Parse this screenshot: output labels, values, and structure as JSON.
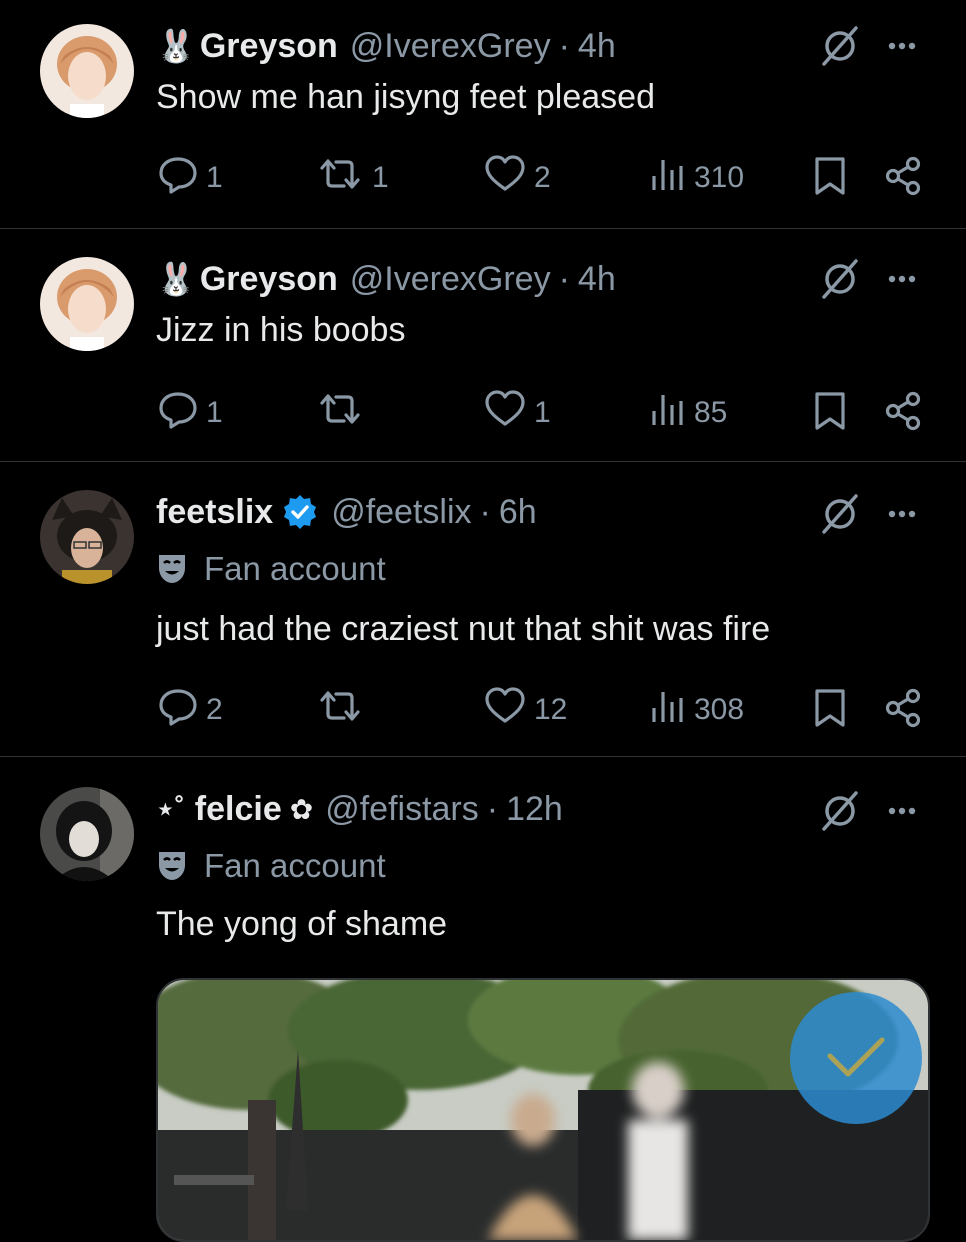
{
  "posts": [
    {
      "name": "Greyson",
      "name_emoji": "🐰",
      "handle": "@IverexGrey",
      "separator": "·",
      "time": "4h",
      "text": "Show me han jisyng feet pleased",
      "replies": "1",
      "reposts": "1",
      "likes": "2",
      "views": "310"
    },
    {
      "name": "Greyson",
      "name_emoji": "🐰",
      "handle": "@IverexGrey",
      "separator": "·",
      "time": "4h",
      "text": "Jizz in his boobs",
      "replies": "1",
      "reposts": "",
      "likes": "1",
      "views": "85"
    },
    {
      "name": "feetslix",
      "verified": true,
      "handle": "@feetslix",
      "separator": "·",
      "time": "6h",
      "label": "Fan account",
      "text": "just had the craziest nut that shit was fire",
      "replies": "2",
      "reposts": "",
      "likes": "12",
      "views": "308"
    },
    {
      "name_prefix": "⋆˚",
      "name": "felcie",
      "name_suffix": "✿",
      "handle": "@fefistars",
      "separator": "·",
      "time": "12h",
      "label": "Fan account",
      "text": "The yong of shame"
    }
  ],
  "colors": {
    "background": "#000000",
    "text": "#e7e9ea",
    "muted": "#8b98a5",
    "divider": "#2f3336",
    "verified": "#1d9bf0"
  },
  "icons": [
    "reply-icon",
    "repost-icon",
    "like-icon",
    "views-icon",
    "bookmark-icon",
    "share-icon",
    "grok-icon",
    "more-icon",
    "fan-mask-icon",
    "verified-badge-icon"
  ]
}
